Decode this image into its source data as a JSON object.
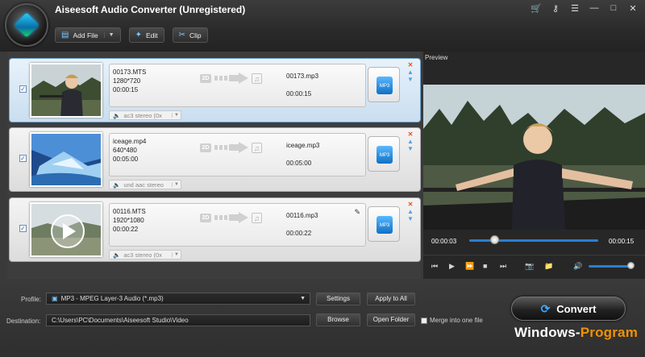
{
  "app": {
    "title": "Aiseesoft Audio Converter (Unregistered)"
  },
  "titlebar_icons": [
    "cart-icon",
    "key-icon",
    "menu-icon",
    "minimize-icon",
    "maximize-icon",
    "close-icon"
  ],
  "toolbar": {
    "add_file": "Add File",
    "edit": "Edit",
    "clip": "Clip"
  },
  "files": [
    {
      "name": "00173.MTS",
      "resolution": "1280*720",
      "duration": "00:00:15",
      "output_name": "00173.mp3",
      "output_duration": "00:00:15",
      "audio_track": "ac3 stereo (0x",
      "checked": true,
      "selected": true
    },
    {
      "name": "iceage.mp4",
      "resolution": "640*480",
      "duration": "00:05:00",
      "output_name": "iceage.mp3",
      "output_duration": "00:05:00",
      "audio_track": "und aac stereo",
      "checked": true,
      "selected": false
    },
    {
      "name": "00116.MTS",
      "resolution": "1920*1080",
      "duration": "00:00:22",
      "output_name": "00116.mp3",
      "output_duration": "00:00:22",
      "audio_track": "ac3 stereo (0x",
      "checked": true,
      "selected": false
    }
  ],
  "conv_badge": "2D",
  "profile_badge": "MP3",
  "preview": {
    "label": "Preview",
    "current_time": "00:00:03",
    "total_time": "00:00:15",
    "progress": 0.2,
    "volume": 0.95
  },
  "bottom": {
    "profile_label": "Profile:",
    "profile_value": "MP3 - MPEG Layer-3 Audio (*.mp3)",
    "settings": "Settings",
    "apply_all": "Apply to All",
    "destination_label": "Destination:",
    "destination_value": "C:\\Users\\PC\\Documents\\Aiseesoft Studio\\Video",
    "browse": "Browse",
    "open_folder": "Open Folder",
    "merge": "Merge into one file",
    "convert": "Convert"
  },
  "watermark": {
    "part1": "Windows-",
    "part2": "Program"
  },
  "colors": {
    "accent": "#2a7fd0",
    "selected_row": "#c9def0",
    "watermark_orange": "#f29100"
  }
}
